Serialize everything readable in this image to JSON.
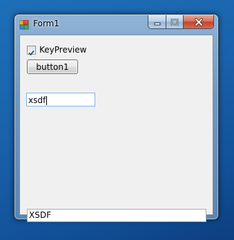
{
  "window": {
    "title": "Form1",
    "caption_buttons": [
      "minimize",
      "maximize",
      "close"
    ]
  },
  "form": {
    "checkbox": {
      "label": "KeyPreview",
      "checked": true
    },
    "button1": {
      "label": "button1"
    },
    "textbox1": {
      "value": "xsdf"
    },
    "textbox2": {
      "value": "XSDF"
    }
  },
  "colors": {
    "desktop": "#1a63ac",
    "client_bg": "#f0f0f0",
    "focus_border": "#7eb4ea",
    "close_button": "#c2452b"
  }
}
